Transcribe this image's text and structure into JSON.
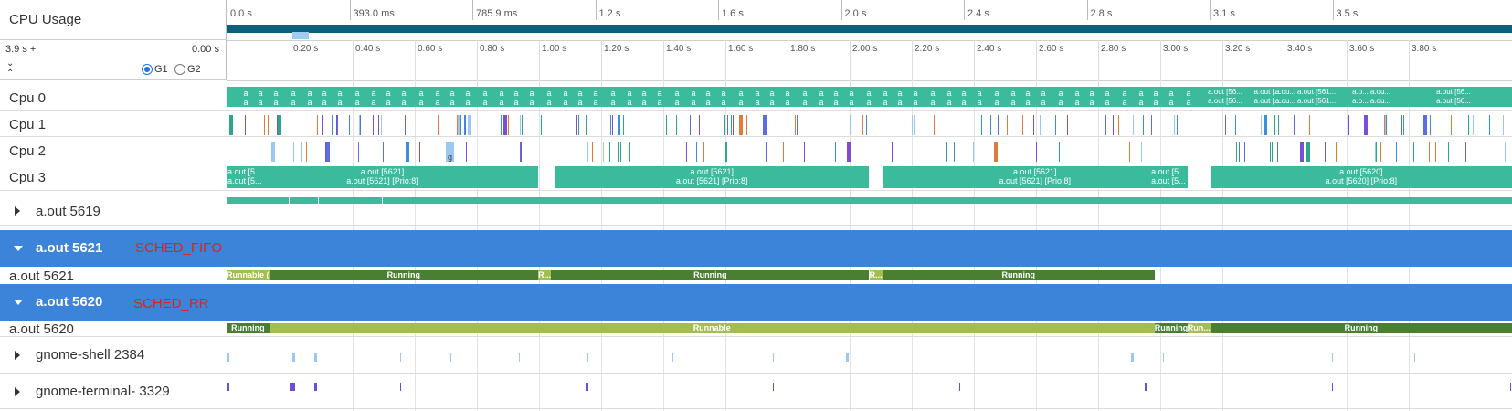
{
  "header": {
    "title": "CPU Usage",
    "range_start_label": "3.9 s +",
    "range_end_label": "0.00 s",
    "group_options": [
      "G1",
      "G2"
    ],
    "group_selected": "G1",
    "top_ticks": [
      "0.0 s",
      "393.0 ms",
      "785.9 ms",
      "1.2 s",
      "1.6 s",
      "2.0 s",
      "2.4 s",
      "2.8 s",
      "3.1 s",
      "3.5 s"
    ],
    "ruler_ticks": [
      "0.20 s",
      "0.40 s",
      "0.60 s",
      "0.80 s",
      "1.00 s",
      "1.20 s",
      "1.40 s",
      "1.60 s",
      "1.80 s",
      "2.00 s",
      "2.20 s",
      "2.40 s",
      "2.60 s",
      "2.80 s",
      "3.00 s",
      "3.20 s",
      "3.40 s",
      "3.60 s",
      "3.80 s"
    ]
  },
  "cpus": [
    {
      "label": "Cpu 0",
      "slice_text": "a",
      "slice_texts_wide": [
        "a.out [56...",
        "a.out [...",
        "a.ou...",
        "a.out [561...",
        "a.o...",
        "a.ou...",
        "a.out [56..."
      ]
    },
    {
      "label": "Cpu 1"
    },
    {
      "label": "Cpu 2",
      "marker_text": "g"
    },
    {
      "label": "Cpu 3",
      "slices": [
        {
          "start": 0.0,
          "end": 0.95,
          "top": "a.out [5621]",
          "bottom": "a.out [5621] [Prio:8]",
          "left_top": "a.out [5...",
          "left_bottom": "a.out [5..."
        },
        {
          "start": 1.0,
          "end": 1.96,
          "top": "a.out [5621]",
          "bottom": "a.out [5621] [Prio:8]"
        },
        {
          "start": 2.0,
          "end": 2.93,
          "top": "a.out [5621]",
          "bottom": "a.out [5621] [Prio:8]",
          "right_top": "a.out [5...",
          "right_bottom": "a.out [5..."
        },
        {
          "start": 3.0,
          "end": 3.92,
          "top": "a.out [5620]",
          "bottom": "a.out [5620] [Prio:8]"
        }
      ]
    }
  ],
  "processes": [
    {
      "name": "a.out 5619",
      "expanded": false
    },
    {
      "name": "a.out 5621",
      "expanded": true,
      "policy": "SCHED_FIFO",
      "thread": {
        "name": "a.out 5621",
        "states": [
          {
            "start": 0.0,
            "end": 0.13,
            "state": "Runnable (...",
            "color": "#a3bd4f"
          },
          {
            "start": 0.13,
            "end": 0.95,
            "state": "Running",
            "color": "#4a7f31"
          },
          {
            "start": 0.95,
            "end": 0.99,
            "state": "R...",
            "color": "#a3bd4f"
          },
          {
            "start": 0.99,
            "end": 1.96,
            "state": "Running",
            "color": "#4a7f31"
          },
          {
            "start": 1.96,
            "end": 2.0,
            "state": "R...",
            "color": "#a3bd4f"
          },
          {
            "start": 2.0,
            "end": 2.83,
            "state": "Running",
            "color": "#4a7f31"
          }
        ]
      }
    },
    {
      "name": "a.out 5620",
      "expanded": true,
      "policy": "SCHED_RR",
      "thread": {
        "name": "a.out 5620",
        "states": [
          {
            "start": 0.0,
            "end": 0.13,
            "state": "Running",
            "color": "#4a7f31"
          },
          {
            "start": 0.13,
            "end": 2.83,
            "state": "Runnable",
            "color": "#a3bd4f"
          },
          {
            "start": 2.83,
            "end": 2.93,
            "state": "Running",
            "color": "#4a7f31"
          },
          {
            "start": 2.93,
            "end": 3.0,
            "state": "Run...",
            "color": "#a3bd4f"
          },
          {
            "start": 3.0,
            "end": 3.92,
            "state": "Running",
            "color": "#4a7f31"
          }
        ]
      }
    },
    {
      "name": "gnome-shell 2384",
      "expanded": false
    },
    {
      "name": "gnome-terminal- 3329",
      "expanded": false
    }
  ],
  "colors": {
    "cpu_slice": "#3bba9c",
    "band": "#3c84d9",
    "overview_bar": "#0d5f7b",
    "policy_text": "#e02020"
  }
}
